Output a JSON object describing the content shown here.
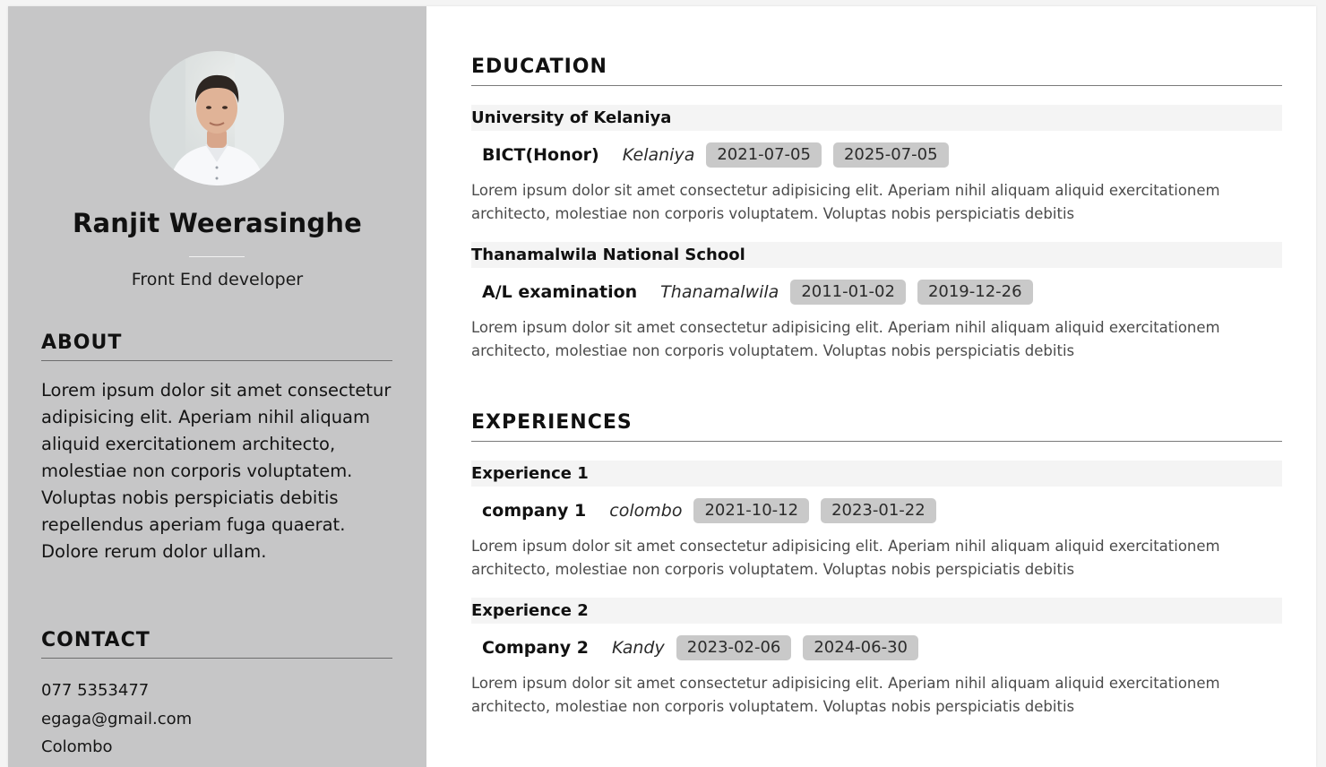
{
  "profile": {
    "name": "Ranjit Weerasinghe",
    "role": "Front End developer"
  },
  "about": {
    "heading": "ABOUT",
    "text": "Lorem ipsum dolor sit amet consectetur adipisicing elit. Aperiam nihil aliquam aliquid exercitationem architecto, molestiae non corporis voluptatem. Voluptas nobis perspiciatis debitis repellendus aperiam fuga quaerat. Dolore rerum dolor ullam."
  },
  "contact": {
    "heading": "CONTACT",
    "phone": "077 5353477",
    "email": "egaga@gmail.com",
    "city": "Colombo"
  },
  "education": {
    "heading": "EDUCATION",
    "entries": [
      {
        "institution": "University of Kelaniya",
        "title": "BICT(Honor)",
        "place": "Kelaniya",
        "start": "2021-07-05",
        "end": "2025-07-05",
        "description": "Lorem ipsum dolor sit amet consectetur adipisicing elit. Aperiam nihil aliquam aliquid exercitationem architecto, molestiae non corporis voluptatem. Voluptas nobis perspiciatis debitis"
      },
      {
        "institution": "Thanamalwila National School",
        "title": "A/L examination",
        "place": "Thanamalwila",
        "start": "2011-01-02",
        "end": "2019-12-26",
        "description": "Lorem ipsum dolor sit amet consectetur adipisicing elit. Aperiam nihil aliquam aliquid exercitationem architecto, molestiae non corporis voluptatem. Voluptas nobis perspiciatis debitis"
      }
    ]
  },
  "experiences": {
    "heading": "EXPERIENCES",
    "entries": [
      {
        "label": "Experience 1",
        "company": "company 1",
        "place": "colombo",
        "start": "2021-10-12",
        "end": "2023-01-22",
        "description": "Lorem ipsum dolor sit amet consectetur adipisicing elit. Aperiam nihil aliquam aliquid exercitationem architecto, molestiae non corporis voluptatem. Voluptas nobis perspiciatis debitis"
      },
      {
        "label": "Experience 2",
        "company": "Company 2",
        "place": "Kandy",
        "start": "2023-02-06",
        "end": "2024-06-30",
        "description": "Lorem ipsum dolor sit amet consectetur adipisicing elit. Aperiam nihil aliquam aliquid exercitationem architecto, molestiae non corporis voluptatem. Voluptas nobis perspiciatis debitis"
      }
    ]
  },
  "colors": {
    "sidebar_bg": "#c6c6c7",
    "badge_bg": "#c9c9c9",
    "entry_head_bg": "#f4f4f4"
  }
}
